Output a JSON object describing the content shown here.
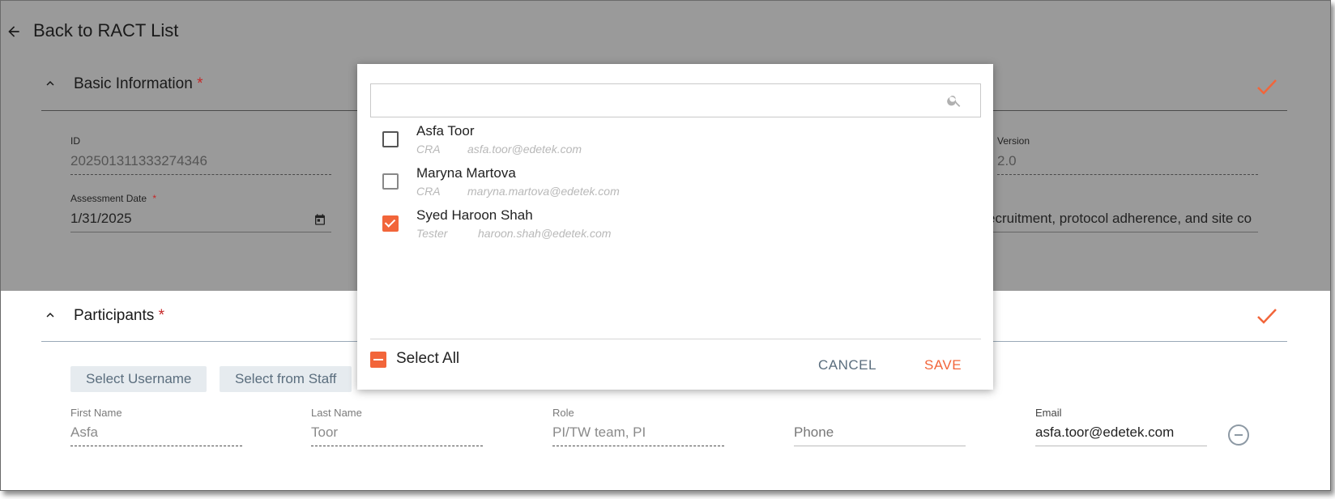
{
  "header": {
    "back_label": "Back to RACT List"
  },
  "basic_info": {
    "title": "Basic Information",
    "required_mark": "*",
    "id_label": "ID",
    "id_value": "202501311333274346",
    "version_label": "Version",
    "version_value": "2.0",
    "assessment_date_label": "Assessment Date",
    "assessment_date_value": "1/31/2025",
    "description_value": "ecruitment, protocol adherence, and site co"
  },
  "participants": {
    "title": "Participants",
    "required_mark": "*",
    "select_username": "Select Username",
    "select_from_staff": "Select from Staff",
    "first_name_label": "First Name",
    "first_name_value": "Asfa",
    "last_name_label": "Last Name",
    "last_name_value": "Toor",
    "role_label": "Role",
    "role_value": "PI/TW team, PI",
    "phone_placeholder": "Phone",
    "email_label": "Email",
    "email_value": "asfa.toor@edetek.com"
  },
  "modal": {
    "search_placeholder": "",
    "people": [
      {
        "name": "Asfa Toor",
        "role": "CRA",
        "email": "asfa.toor@edetek.com",
        "checked": false
      },
      {
        "name": "Maryna Martova",
        "role": "CRA",
        "email": "maryna.martova@edetek.com",
        "checked": false
      },
      {
        "name": "Syed Haroon Shah",
        "role": "Tester",
        "email": "haroon.shah@edetek.com",
        "checked": true
      }
    ],
    "select_all_label": "Select All",
    "cancel_label": "CANCEL",
    "save_label": "SAVE"
  },
  "colors": {
    "accent": "#f2653a",
    "overlay": "#9a9a9a",
    "required": "#c62828",
    "chip_bg": "#e6ebef"
  }
}
